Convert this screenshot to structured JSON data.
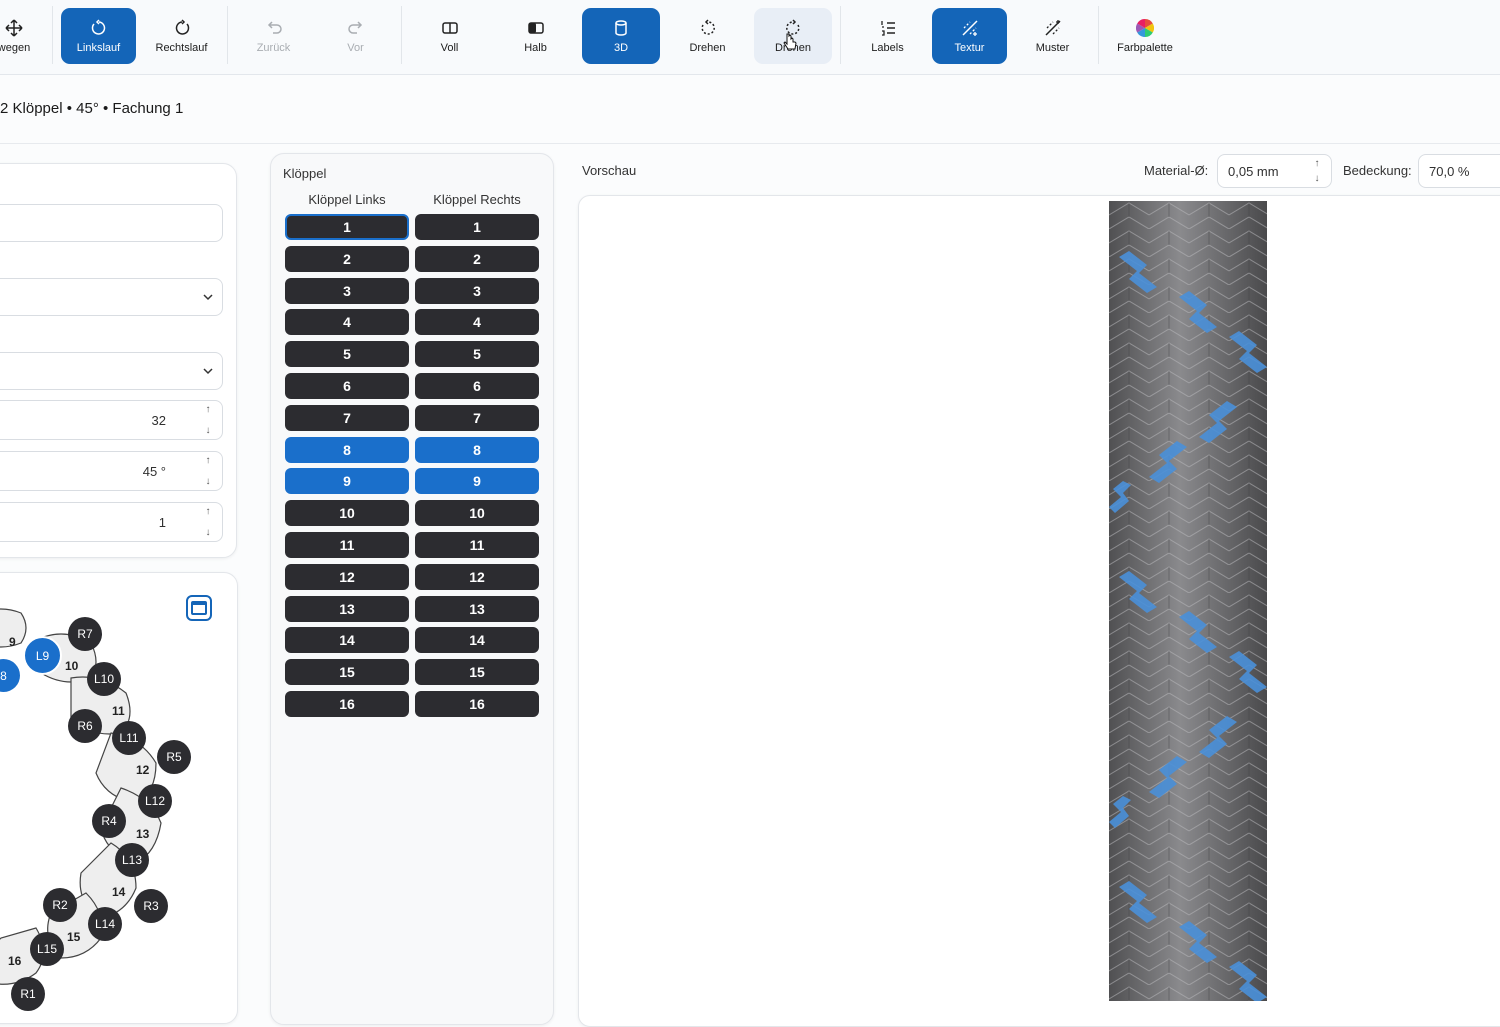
{
  "toolbar": {
    "items": [
      {
        "label": "wegen",
        "icon": "move-icon"
      },
      {
        "label": "Linkslauf",
        "icon": "rotate-left-icon",
        "state": "active"
      },
      {
        "label": "Rechtslauf",
        "icon": "rotate-right-icon"
      },
      {
        "label": "Zurück",
        "icon": "undo-icon",
        "state": "disabled"
      },
      {
        "label": "Vor",
        "icon": "redo-icon",
        "state": "disabled"
      },
      {
        "label": "Voll",
        "icon": "full-view-icon"
      },
      {
        "label": "Halb",
        "icon": "half-view-icon"
      },
      {
        "label": "3D",
        "icon": "cylinder-3d-icon",
        "state": "active"
      },
      {
        "label": "Drehen",
        "icon": "rotate-ccw-icon"
      },
      {
        "label": "Drehen",
        "icon": "rotate-cw-icon",
        "state": "hover"
      },
      {
        "label": "Labels",
        "icon": "numbered-list-icon"
      },
      {
        "label": "Textur",
        "icon": "texture-wand-icon",
        "state": "active"
      },
      {
        "label": "Muster",
        "icon": "pattern-wand-icon"
      },
      {
        "label": "Farbpalette",
        "icon": "color-wheel-icon"
      }
    ]
  },
  "subheader": "2 Klöppel • 45° • Fachung 1",
  "settings": {
    "fields": [
      {
        "type": "text",
        "value": ""
      },
      {
        "type": "select",
        "value": ""
      },
      {
        "type": "select",
        "value": ""
      },
      {
        "type": "number",
        "value": "32"
      },
      {
        "type": "number",
        "value": "45 °"
      },
      {
        "type": "number",
        "value": "1"
      }
    ]
  },
  "kloeppel": {
    "title": "Klöppel",
    "left_header": "Klöppel Links",
    "right_header": "Klöppel Rechts",
    "rows": [
      "1",
      "2",
      "3",
      "4",
      "5",
      "6",
      "7",
      "8",
      "9",
      "10",
      "11",
      "12",
      "13",
      "14",
      "15",
      "16"
    ],
    "selected": [
      "8",
      "9"
    ],
    "focused_left": "1"
  },
  "preview": {
    "title": "Vorschau",
    "material_label": "Material-Ø:",
    "material_value": "0,05 mm",
    "coverage_label": "Bedeckung:",
    "coverage_value": "70,0 %"
  },
  "diagram": {
    "nodes": [
      {
        "label": "9",
        "kind": "gear"
      },
      {
        "label": "R7",
        "kind": "dark"
      },
      {
        "label": "L9",
        "kind": "blue"
      },
      {
        "label": "8",
        "kind": "blue"
      },
      {
        "label": "10",
        "kind": "gear"
      },
      {
        "label": "L10",
        "kind": "dark"
      },
      {
        "label": "11",
        "kind": "gear"
      },
      {
        "label": "R6",
        "kind": "dark"
      },
      {
        "label": "L11",
        "kind": "dark"
      },
      {
        "label": "R5",
        "kind": "dark"
      },
      {
        "label": "12",
        "kind": "gear"
      },
      {
        "label": "L12",
        "kind": "dark"
      },
      {
        "label": "R4",
        "kind": "dark"
      },
      {
        "label": "13",
        "kind": "gear"
      },
      {
        "label": "L13",
        "kind": "dark"
      },
      {
        "label": "14",
        "kind": "gear"
      },
      {
        "label": "R2",
        "kind": "dark"
      },
      {
        "label": "R3",
        "kind": "dark"
      },
      {
        "label": "L14",
        "kind": "dark"
      },
      {
        "label": "15",
        "kind": "gear"
      },
      {
        "label": "L15",
        "kind": "dark"
      },
      {
        "label": "16",
        "kind": "gear"
      },
      {
        "label": "R1",
        "kind": "dark"
      }
    ]
  },
  "colors": {
    "accent": "#1465b8",
    "bobbin": "#2c2c30",
    "selected": "#1a6fcb",
    "braid_gray": "#6f6f72",
    "braid_blue": "#4a90d9"
  }
}
